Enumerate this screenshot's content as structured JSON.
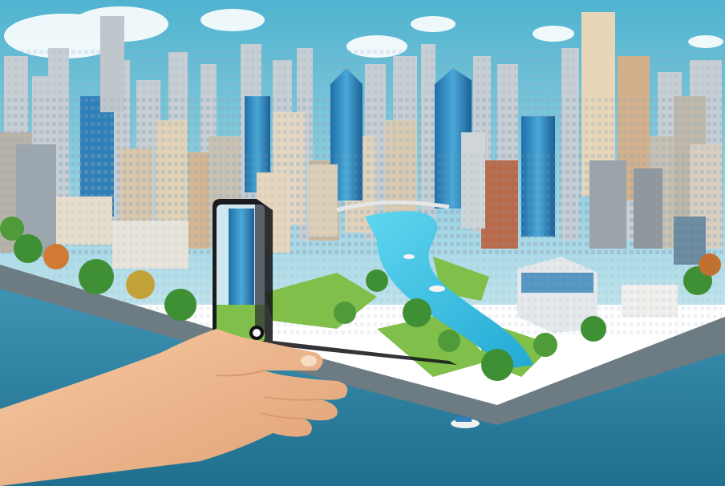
{
  "image": {
    "kind": "illustration",
    "scene": "isometric-city-with-river-viewed-through-smartphone",
    "colors": {
      "sky_top": "#4fb3cf",
      "sky_bottom": "#bfe3ec",
      "water_deep": "#1f6f8e",
      "water_light": "#3f93b3",
      "river": "#39c6e6",
      "grass": "#7fbf4a",
      "tree": "#3f8f35",
      "glass_tower": "#2f7fb8",
      "beige_building": "#e8d6b8",
      "brick_building": "#b86a4a",
      "skin": "#f1b98f",
      "phone_body": "#1b1b1f"
    }
  }
}
